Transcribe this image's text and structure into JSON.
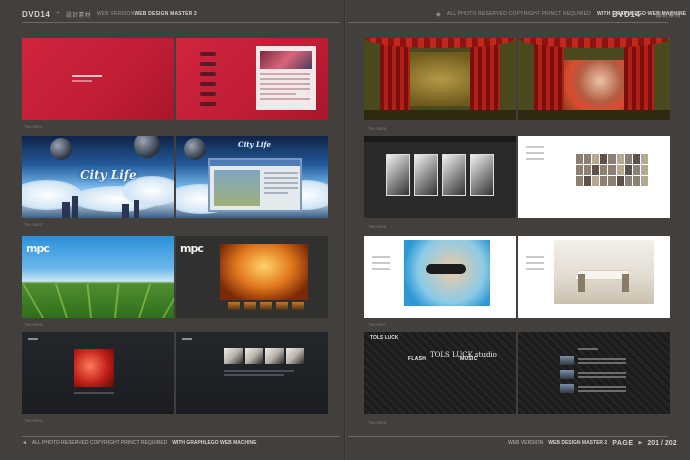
{
  "header": {
    "left_dvd": "DVD14",
    "left_sep": "+",
    "left_cjk": "設計素材",
    "left_series_prefix": "WEB VERSION",
    "left_series_title": "WEB DESIGN MASTER 2",
    "right_copyright": "ALL PHOTO RESERVED COPYRIGHT PRINCT REQUIRED",
    "right_studio": "WITH GRAPHLEGO WEB MACHINE",
    "right_dvd": "DVD14",
    "right_sep": "+",
    "right_cjk": "設計素材"
  },
  "footer": {
    "left_arrow": "◄",
    "left_copyright": "ALL PHOTO RESERVED COPYRIGHT PRINCT REQUIRED",
    "left_studio": "WITH GRAPHLEGO WEB MACHINE",
    "right_series_prefix": "WEB VERSION",
    "right_series_title": "WEB DESIGN MASTER 2",
    "page_label": "PAGE",
    "page_sep": "▶",
    "page_numbers": "201 / 202"
  },
  "captions": {
    "left": [
      "TW-0001",
      "TW-0002",
      "TW-0003",
      "TW-0004"
    ],
    "right": [
      "TW-0005",
      "TW-0006",
      "TW-0007",
      "TW-0008"
    ]
  },
  "tiles": {
    "city_title": "City Life",
    "city_title_small": "City Life",
    "mpc_logo": "mpc",
    "mpc_logo_2": "mpc",
    "stripes_logo": "TOLS LUCK",
    "stripes_menu_left": "FLASH",
    "stripes_menu_right": "MUSIC",
    "stripes_studio": "TOLS LUCK studio"
  }
}
